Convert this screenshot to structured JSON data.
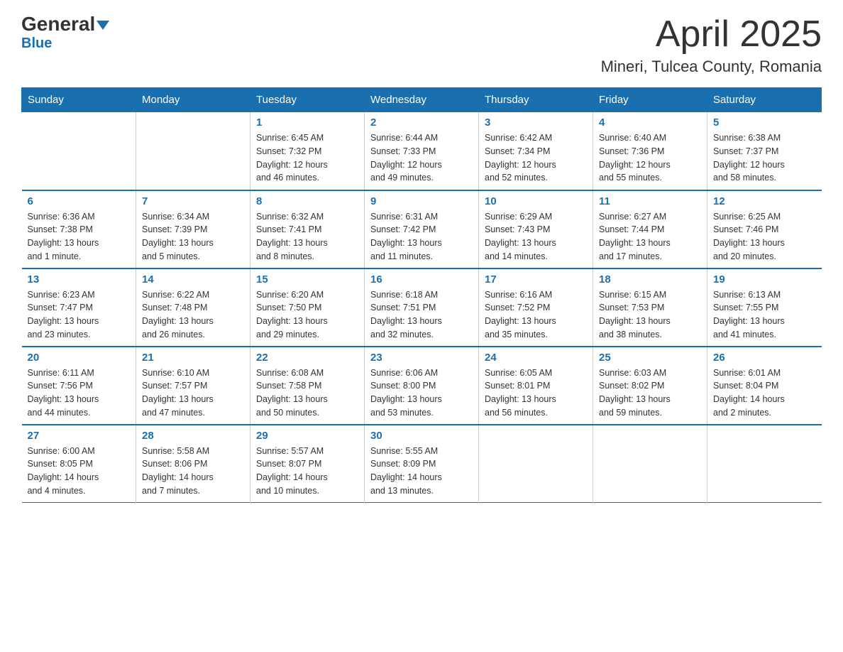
{
  "header": {
    "logo_general": "General",
    "logo_blue": "Blue",
    "title": "April 2025",
    "subtitle": "Mineri, Tulcea County, Romania"
  },
  "weekdays": [
    "Sunday",
    "Monday",
    "Tuesday",
    "Wednesday",
    "Thursday",
    "Friday",
    "Saturday"
  ],
  "weeks": [
    [
      {
        "day": "",
        "info": ""
      },
      {
        "day": "",
        "info": ""
      },
      {
        "day": "1",
        "info": "Sunrise: 6:45 AM\nSunset: 7:32 PM\nDaylight: 12 hours\nand 46 minutes."
      },
      {
        "day": "2",
        "info": "Sunrise: 6:44 AM\nSunset: 7:33 PM\nDaylight: 12 hours\nand 49 minutes."
      },
      {
        "day": "3",
        "info": "Sunrise: 6:42 AM\nSunset: 7:34 PM\nDaylight: 12 hours\nand 52 minutes."
      },
      {
        "day": "4",
        "info": "Sunrise: 6:40 AM\nSunset: 7:36 PM\nDaylight: 12 hours\nand 55 minutes."
      },
      {
        "day": "5",
        "info": "Sunrise: 6:38 AM\nSunset: 7:37 PM\nDaylight: 12 hours\nand 58 minutes."
      }
    ],
    [
      {
        "day": "6",
        "info": "Sunrise: 6:36 AM\nSunset: 7:38 PM\nDaylight: 13 hours\nand 1 minute."
      },
      {
        "day": "7",
        "info": "Sunrise: 6:34 AM\nSunset: 7:39 PM\nDaylight: 13 hours\nand 5 minutes."
      },
      {
        "day": "8",
        "info": "Sunrise: 6:32 AM\nSunset: 7:41 PM\nDaylight: 13 hours\nand 8 minutes."
      },
      {
        "day": "9",
        "info": "Sunrise: 6:31 AM\nSunset: 7:42 PM\nDaylight: 13 hours\nand 11 minutes."
      },
      {
        "day": "10",
        "info": "Sunrise: 6:29 AM\nSunset: 7:43 PM\nDaylight: 13 hours\nand 14 minutes."
      },
      {
        "day": "11",
        "info": "Sunrise: 6:27 AM\nSunset: 7:44 PM\nDaylight: 13 hours\nand 17 minutes."
      },
      {
        "day": "12",
        "info": "Sunrise: 6:25 AM\nSunset: 7:46 PM\nDaylight: 13 hours\nand 20 minutes."
      }
    ],
    [
      {
        "day": "13",
        "info": "Sunrise: 6:23 AM\nSunset: 7:47 PM\nDaylight: 13 hours\nand 23 minutes."
      },
      {
        "day": "14",
        "info": "Sunrise: 6:22 AM\nSunset: 7:48 PM\nDaylight: 13 hours\nand 26 minutes."
      },
      {
        "day": "15",
        "info": "Sunrise: 6:20 AM\nSunset: 7:50 PM\nDaylight: 13 hours\nand 29 minutes."
      },
      {
        "day": "16",
        "info": "Sunrise: 6:18 AM\nSunset: 7:51 PM\nDaylight: 13 hours\nand 32 minutes."
      },
      {
        "day": "17",
        "info": "Sunrise: 6:16 AM\nSunset: 7:52 PM\nDaylight: 13 hours\nand 35 minutes."
      },
      {
        "day": "18",
        "info": "Sunrise: 6:15 AM\nSunset: 7:53 PM\nDaylight: 13 hours\nand 38 minutes."
      },
      {
        "day": "19",
        "info": "Sunrise: 6:13 AM\nSunset: 7:55 PM\nDaylight: 13 hours\nand 41 minutes."
      }
    ],
    [
      {
        "day": "20",
        "info": "Sunrise: 6:11 AM\nSunset: 7:56 PM\nDaylight: 13 hours\nand 44 minutes."
      },
      {
        "day": "21",
        "info": "Sunrise: 6:10 AM\nSunset: 7:57 PM\nDaylight: 13 hours\nand 47 minutes."
      },
      {
        "day": "22",
        "info": "Sunrise: 6:08 AM\nSunset: 7:58 PM\nDaylight: 13 hours\nand 50 minutes."
      },
      {
        "day": "23",
        "info": "Sunrise: 6:06 AM\nSunset: 8:00 PM\nDaylight: 13 hours\nand 53 minutes."
      },
      {
        "day": "24",
        "info": "Sunrise: 6:05 AM\nSunset: 8:01 PM\nDaylight: 13 hours\nand 56 minutes."
      },
      {
        "day": "25",
        "info": "Sunrise: 6:03 AM\nSunset: 8:02 PM\nDaylight: 13 hours\nand 59 minutes."
      },
      {
        "day": "26",
        "info": "Sunrise: 6:01 AM\nSunset: 8:04 PM\nDaylight: 14 hours\nand 2 minutes."
      }
    ],
    [
      {
        "day": "27",
        "info": "Sunrise: 6:00 AM\nSunset: 8:05 PM\nDaylight: 14 hours\nand 4 minutes."
      },
      {
        "day": "28",
        "info": "Sunrise: 5:58 AM\nSunset: 8:06 PM\nDaylight: 14 hours\nand 7 minutes."
      },
      {
        "day": "29",
        "info": "Sunrise: 5:57 AM\nSunset: 8:07 PM\nDaylight: 14 hours\nand 10 minutes."
      },
      {
        "day": "30",
        "info": "Sunrise: 5:55 AM\nSunset: 8:09 PM\nDaylight: 14 hours\nand 13 minutes."
      },
      {
        "day": "",
        "info": ""
      },
      {
        "day": "",
        "info": ""
      },
      {
        "day": "",
        "info": ""
      }
    ]
  ]
}
